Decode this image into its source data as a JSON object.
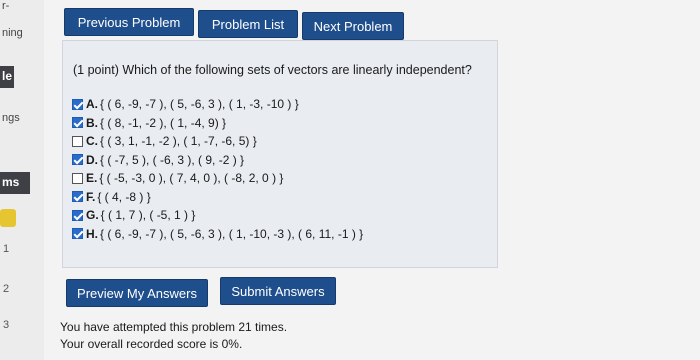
{
  "sidebar": {
    "frag_top": "r-",
    "frag_ning": "ning",
    "frag_le": "le",
    "frag_ngs": "ngs",
    "frag_ms": "ms",
    "numbers": [
      "1",
      "2",
      "3"
    ]
  },
  "nav": {
    "prev": "Previous Problem",
    "list": "Problem List",
    "next": "Next Problem"
  },
  "problem": {
    "question": "(1 point) Which of the following sets of vectors are linearly independent?",
    "options": [
      {
        "letter": "A.",
        "text": "{ ( 6, -9, -7 ), ( 5, -6, 3 ), ( 1, -3, -10 ) }",
        "checked": true
      },
      {
        "letter": "B.",
        "text": "{ ( 8, -1, -2 ), ( 1, -4, 9) }",
        "checked": true
      },
      {
        "letter": "C.",
        "text": "{ ( 3, 1, -1, -2 ), ( 1, -7, -6, 5) }",
        "checked": false
      },
      {
        "letter": "D.",
        "text": "{ ( -7, 5 ), ( -6, 3 ), ( 9, -2 ) }",
        "checked": true
      },
      {
        "letter": "E.",
        "text": "{ ( -5, -3, 0 ), ( 7, 4, 0 ), ( -8, 2, 0 ) }",
        "checked": false
      },
      {
        "letter": "F.",
        "text": "{ ( 4, -8 ) }",
        "checked": true
      },
      {
        "letter": "G.",
        "text": "{ ( 1, 7 ), ( -5, 1 ) }",
        "checked": true
      },
      {
        "letter": "H.",
        "text": "{ ( 6, -9, -7 ), ( 5, -6, 3 ), ( 1, -10, -3 ), ( 6, 11, -1 ) }",
        "checked": true
      }
    ]
  },
  "actions": {
    "preview": "Preview My Answers",
    "submit": "Submit Answers"
  },
  "status": {
    "attempts": "You have attempted this problem 21 times.",
    "score": "Your overall recorded score is 0%."
  },
  "colors": {
    "button_bg": "#1f4e8c",
    "checkbox_checked": "#2a6ccc"
  }
}
